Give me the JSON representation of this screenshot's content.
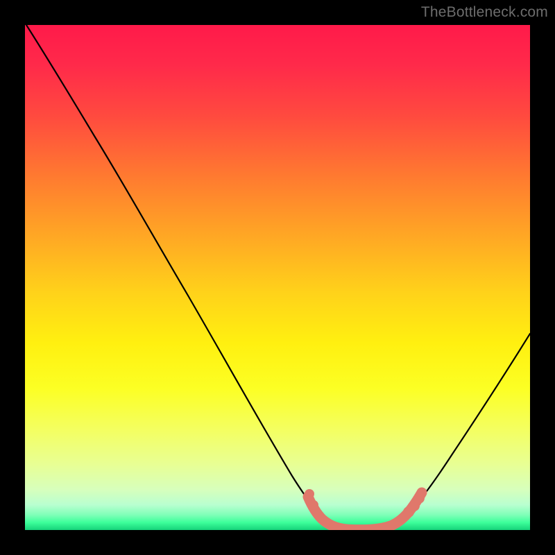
{
  "watermark": {
    "text": "TheBottleneck.com"
  },
  "chart_data": {
    "type": "line",
    "title": "",
    "xlabel": "",
    "ylabel": "",
    "xlim": [
      0,
      100
    ],
    "ylim": [
      0,
      100
    ],
    "series": [
      {
        "name": "curve",
        "x": [
          0,
          5,
          10,
          15,
          20,
          25,
          30,
          35,
          40,
          45,
          50,
          52,
          57,
          60,
          62,
          65,
          70,
          72,
          75,
          80,
          85,
          90,
          95,
          100
        ],
        "values": [
          100,
          95,
          89,
          82,
          74,
          66,
          57.5,
          48.5,
          39,
          29,
          18,
          12,
          4,
          1.5,
          0.5,
          0,
          0,
          0.5,
          2,
          8,
          17,
          27,
          37,
          48
        ]
      },
      {
        "name": "optimal-range-marker",
        "x": [
          57,
          58,
          60,
          62,
          64,
          66,
          68,
          70,
          72,
          74,
          75
        ],
        "values": [
          6,
          4,
          1.8,
          0.7,
          0.3,
          0.2,
          0.3,
          0.8,
          1.6,
          3,
          4
        ]
      }
    ],
    "gradient_colors": {
      "top": "#ff1a4a",
      "mid": "#ffe015",
      "bottom": "#16d37a"
    }
  }
}
